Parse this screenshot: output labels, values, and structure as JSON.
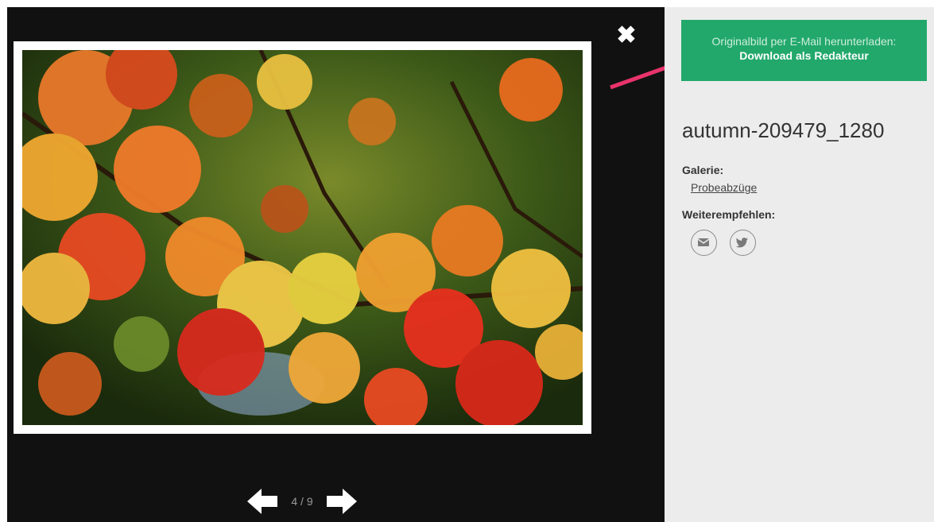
{
  "viewer": {
    "close_icon": "close-icon",
    "counter": "4 / 9",
    "prev_icon": "arrow-left-icon",
    "next_icon": "arrow-right-icon",
    "photo_alt": "autumn-209479_1280"
  },
  "sidebar": {
    "download_button": {
      "line1": "Originalbild per E-Mail herunterladen:",
      "line2": "Download als Redakteur"
    },
    "title": "autumn-209479_1280",
    "gallery_label": "Galerie:",
    "gallery_link": "Probeabzüge",
    "share_label": "Weiterempfehlen:",
    "share_icons": [
      "email-icon",
      "twitter-icon"
    ]
  },
  "colors": {
    "viewer_bg": "#111111",
    "sidebar_bg": "#ececec",
    "accent_green": "#22a86b",
    "pointer_pink": "#e8336b"
  }
}
